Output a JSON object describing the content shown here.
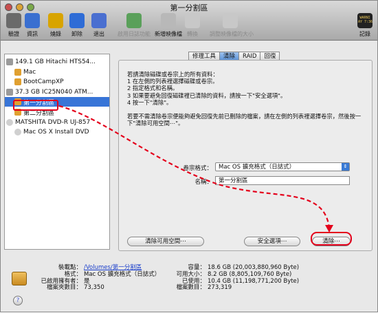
{
  "window": {
    "title": "第一分割區"
  },
  "toolbar": [
    {
      "label": "驗證",
      "color": "#6a6a6a",
      "enabled": true
    },
    {
      "label": "資訊",
      "color": "#3a6fd0",
      "enabled": true
    },
    {
      "label": "燒錄",
      "color": "#d8a400",
      "enabled": true
    },
    {
      "label": "卸除",
      "color": "#2e6cd6",
      "enabled": true
    },
    {
      "label": "退出",
      "color": "#4a6fd0",
      "enabled": true
    },
    {
      "label": "啟用日誌功能",
      "color": "#5aa05a",
      "enabled": false
    },
    {
      "label": "新增映像檔",
      "color": "#b8b8b8",
      "enabled": true
    },
    {
      "label": "轉換",
      "color": "#c8c8c8",
      "enabled": false
    },
    {
      "label": "調整映像檔的大小",
      "color": "#c8c8c8",
      "enabled": false
    }
  ],
  "log_button": {
    "label": "記錄",
    "badge": "WARNI\nAY 7:36"
  },
  "sidebar": [
    {
      "label": "149.1 GB Hitachi HTS54...",
      "level": 0,
      "icon": "disk-icon",
      "selected": false
    },
    {
      "label": "Mac",
      "level": 1,
      "icon": "volume-icon",
      "selected": false
    },
    {
      "label": "BootCampXP",
      "level": 1,
      "icon": "volume-icon",
      "selected": false
    },
    {
      "label": "37.3 GB IC25N040 ATM...",
      "level": 0,
      "icon": "disk-icon",
      "selected": false
    },
    {
      "label": "第一分割區",
      "level": 1,
      "icon": "volume-icon",
      "selected": true
    },
    {
      "label": "第二分割區",
      "level": 1,
      "icon": "volume-icon",
      "selected": false
    },
    {
      "label": "MATSHITA DVD-R UJ-857",
      "level": 0,
      "icon": "optical-drive-icon",
      "selected": false
    },
    {
      "label": "Mac OS X Install DVD",
      "level": 1,
      "icon": "dvd-icon",
      "selected": false
    }
  ],
  "tabs": [
    {
      "label": "修理工具",
      "active": false
    },
    {
      "label": "清除",
      "active": true
    },
    {
      "label": "RAID",
      "active": false
    },
    {
      "label": "回復",
      "active": false
    }
  ],
  "instructions": [
    "若請清除磁碟或卷宗上的所有資料：",
    "1  在左側的列表裡選擇磁碟或卷宗。",
    "2  指定格式和名稱。",
    "3  如果要避免回復磁碟裡已清除的資料，請按一下\"安全選項\"。",
    "4  按一下\"清除\"。",
    "",
    "若要不需清除卷宗便能夠避免回復先前已刪除的檔案，請在左側的列表裡選擇卷宗，然後按一",
    "下\"清除可用空間⋯\"。"
  ],
  "form": {
    "format_label": "卷宗格式：",
    "format_value": "Mac OS 擴充格式（日誌式）",
    "name_label": "名稱：",
    "name_value": "第一分割區"
  },
  "buttons": {
    "erase_free_space": "清除可用空間⋯",
    "security_options": "安全選項⋯",
    "erase": "清除⋯"
  },
  "info_left": [
    {
      "label": "裝載點：",
      "value": "/Volumes/第一分割區",
      "link": true
    },
    {
      "label": "格式：",
      "value": "Mac OS 擴充格式（日誌式）"
    },
    {
      "label": "已啟用擁有者：",
      "value": "是"
    },
    {
      "label": "檔案夾數目：",
      "value": "73,350"
    }
  ],
  "info_right": [
    {
      "label": "容量：",
      "value": "18.6 GB (20,003,880,960 Byte)"
    },
    {
      "label": "可用大小：",
      "value": "8.2 GB (8,805,109,760 Byte)"
    },
    {
      "label": "已使用：",
      "value": "10.4 GB (11,198,771,200 Byte)"
    },
    {
      "label": "檔案數目：",
      "value": "273,319"
    }
  ],
  "colors": {
    "selection": "#3875d7",
    "annotation": "#e4001b"
  }
}
